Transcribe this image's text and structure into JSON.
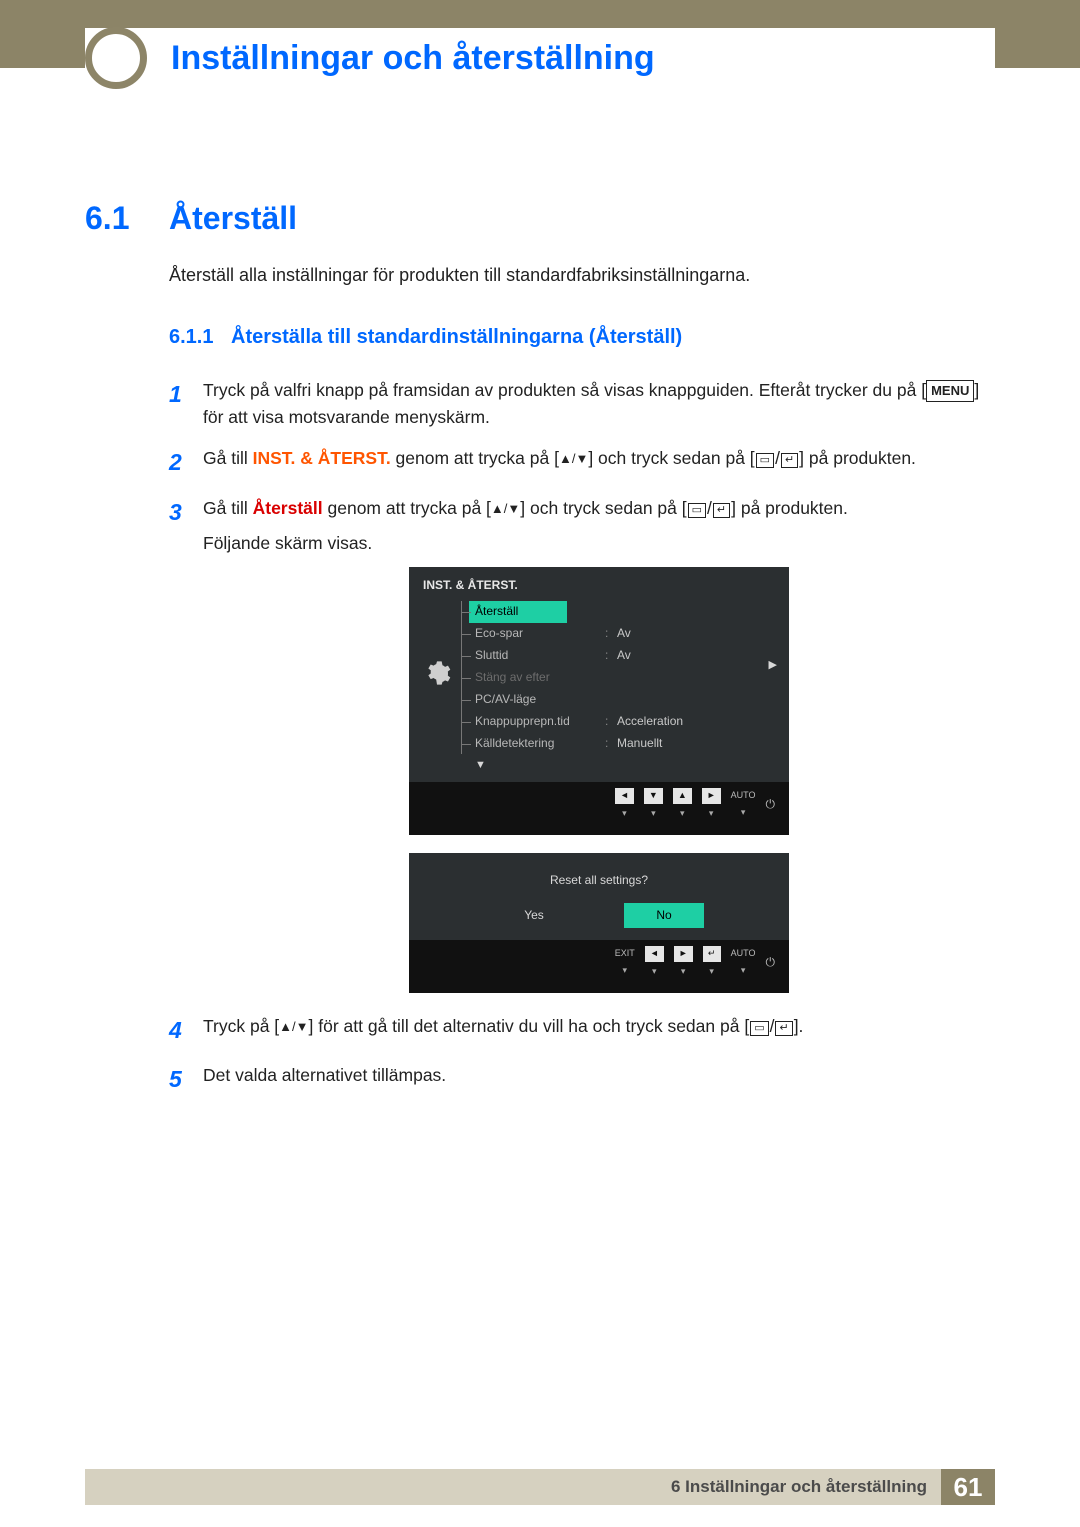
{
  "header": {
    "chapter_title": "Inställningar och återställning"
  },
  "section": {
    "number": "6.1",
    "title": "Återställ"
  },
  "intro": "Återställ alla inställningar för produkten till standardfabriksinställningarna.",
  "subsection": {
    "number": "6.1.1",
    "title": "Återställa till standardinställningarna (Återställ)"
  },
  "steps": {
    "s1_a": "Tryck på valfri knapp på framsidan av produkten så visas knappguiden. Efteråt trycker du på [",
    "s1_menu": "MENU",
    "s1_b": "] för att visa motsvarande menyskärm.",
    "s2_a": "Gå till ",
    "s2_orange": "INST. & ÅTERST.",
    "s2_b": " genom att trycka på [",
    "s2_c": "] och tryck sedan på [",
    "s2_d": "] på produkten.",
    "s3_a": "Gå till ",
    "s3_red": "Återställ",
    "s3_b": " genom att trycka på [",
    "s3_c": "] och tryck sedan på [",
    "s3_d": "] på produkten.",
    "s3_e": "Följande skärm visas.",
    "s4_a": "Tryck på [",
    "s4_b": "] för att gå till det alternativ du vill ha och tryck sedan på [",
    "s4_c": "].",
    "s5": "Det valda alternativet tillämpas."
  },
  "osd": {
    "title": "INST. & ÅTERST.",
    "items": [
      {
        "label": "Återställ",
        "value": "",
        "selected": true
      },
      {
        "label": "Eco-spar",
        "value": "Av"
      },
      {
        "label": "Sluttid",
        "value": "Av"
      },
      {
        "label": "Stäng av efter",
        "value": "",
        "dim": true
      },
      {
        "label": "PC/AV-läge",
        "value": ""
      },
      {
        "label": "Knappupprepn.tid",
        "value": "Acceleration"
      },
      {
        "label": "Källdetektering",
        "value": "Manuellt"
      }
    ],
    "auto": "AUTO"
  },
  "dialog": {
    "question": "Reset all settings?",
    "yes": "Yes",
    "no": "No",
    "exit": "EXIT",
    "auto": "AUTO"
  },
  "footer": {
    "text": "6 Inställningar och återställning",
    "page": "61"
  }
}
